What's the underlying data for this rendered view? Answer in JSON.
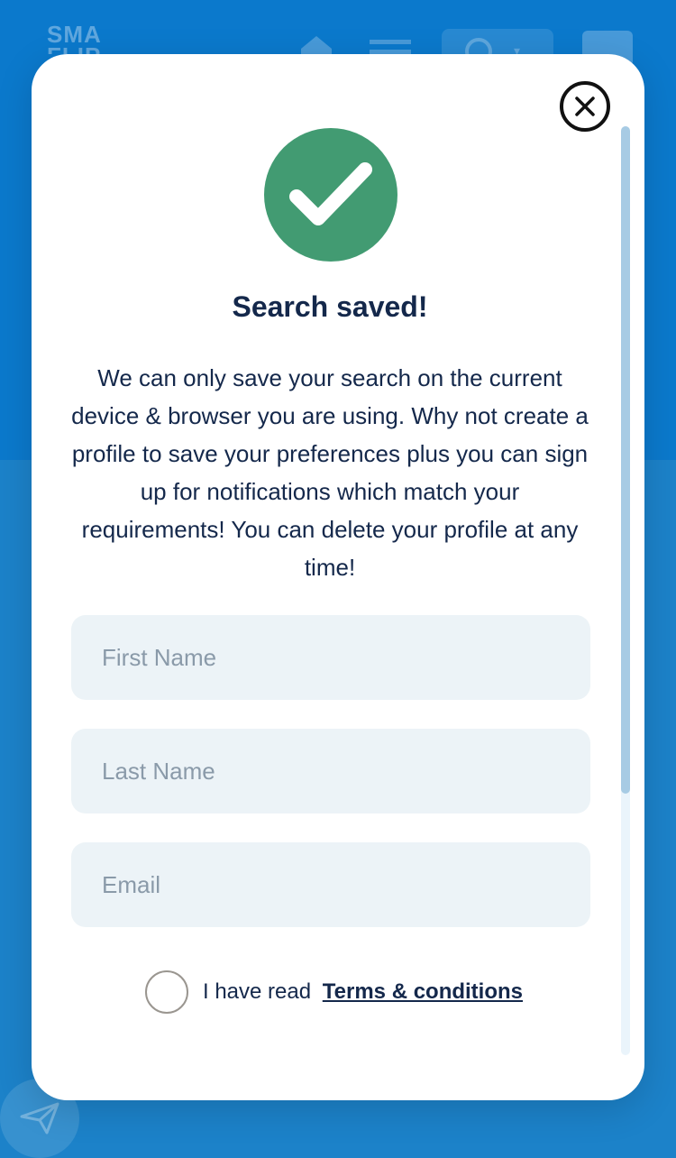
{
  "background": {
    "logo_text": "SMA\nFLIP"
  },
  "modal": {
    "title": "Search saved!",
    "description": "We can only save your search on the current device & browser you are using. Why not create a profile to save your preferences plus you can sign up for notifications which match your requirements! You can delete your profile at any time!",
    "fields": [
      {
        "placeholder": "First Name",
        "value": ""
      },
      {
        "placeholder": "Last Name",
        "value": ""
      },
      {
        "placeholder": "Email",
        "value": ""
      }
    ],
    "terms_prefix": "I have read",
    "terms_link": "Terms & conditions",
    "terms_checked": false
  },
  "colors": {
    "brand_blue": "#0b79cc",
    "success_green": "#429b72",
    "text_navy": "#14284b",
    "field_bg": "#ecf3f7"
  },
  "icons": [
    "close-icon",
    "checkmark-icon",
    "home-icon",
    "menu-icon",
    "location-pin-icon",
    "filter-icon",
    "send-icon"
  ]
}
